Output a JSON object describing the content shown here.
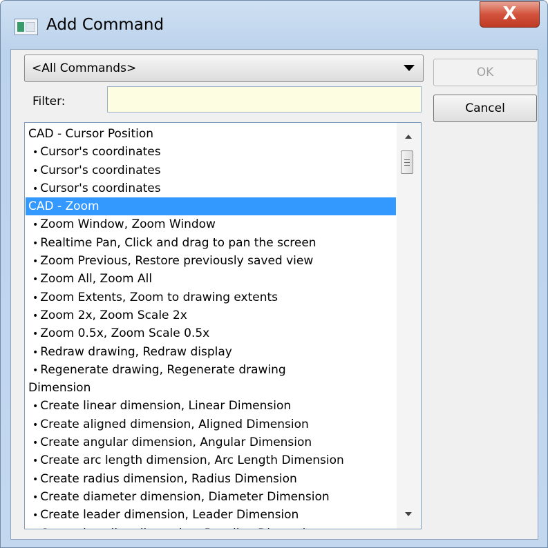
{
  "window": {
    "title": "Add Command",
    "close_label": "X"
  },
  "category_select": {
    "value": "<All Commands>"
  },
  "filter": {
    "label": "Filter:",
    "value": ""
  },
  "buttons": {
    "ok_label": "OK",
    "cancel_label": "Cancel"
  },
  "list": {
    "rows": [
      {
        "text": "CAD - Cursor Position",
        "kind": "group"
      },
      {
        "text": "Cursor's coordinates",
        "kind": "item"
      },
      {
        "text": "Cursor's coordinates",
        "kind": "item"
      },
      {
        "text": "Cursor's coordinates",
        "kind": "item"
      },
      {
        "text": "CAD - Zoom",
        "kind": "group",
        "selected": true
      },
      {
        "text": "Zoom Window, Zoom Window",
        "kind": "item"
      },
      {
        "text": "Realtime Pan, Click and drag to pan the screen",
        "kind": "item"
      },
      {
        "text": "Zoom Previous, Restore previously saved view",
        "kind": "item"
      },
      {
        "text": "Zoom All, Zoom All",
        "kind": "item"
      },
      {
        "text": "Zoom Extents, Zoom to drawing extents",
        "kind": "item"
      },
      {
        "text": "Zoom 2x, Zoom Scale 2x",
        "kind": "item"
      },
      {
        "text": "Zoom 0.5x, Zoom Scale 0.5x",
        "kind": "item"
      },
      {
        "text": "Redraw drawing, Redraw display",
        "kind": "item"
      },
      {
        "text": "Regenerate drawing, Regenerate drawing",
        "kind": "item"
      },
      {
        "text": "Dimension",
        "kind": "group"
      },
      {
        "text": "Create linear dimension, Linear Dimension",
        "kind": "item"
      },
      {
        "text": "Create aligned dimension, Aligned Dimension",
        "kind": "item"
      },
      {
        "text": "Create angular dimension, Angular Dimension",
        "kind": "item"
      },
      {
        "text": "Create arc length dimension, Arc Length Dimension",
        "kind": "item"
      },
      {
        "text": "Create radius dimension, Radius Dimension",
        "kind": "item"
      },
      {
        "text": "Create diameter dimension, Diameter Dimension",
        "kind": "item"
      },
      {
        "text": "Create leader dimension, Leader Dimension",
        "kind": "item"
      },
      {
        "text": "Create baseline dimension, Baseline Dimension",
        "kind": "item"
      }
    ]
  },
  "colors": {
    "selection": "#3399ff",
    "filter_background": "#fdfde2",
    "close_button": "#c8442d"
  },
  "icons": [
    "app-icon",
    "close-icon",
    "dropdown-arrow-icon",
    "scroll-up-icon",
    "scroll-down-icon"
  ]
}
